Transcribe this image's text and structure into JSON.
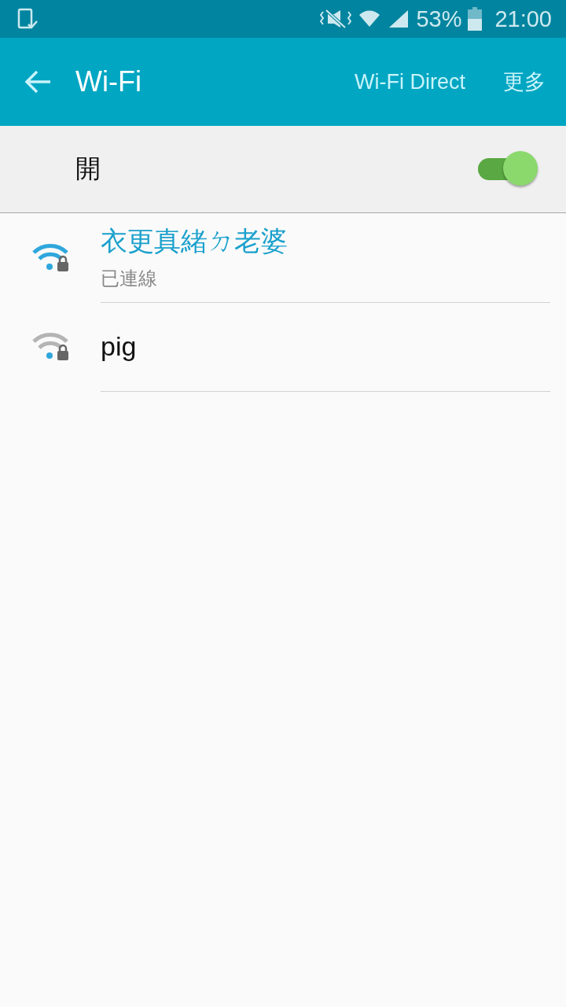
{
  "status_bar": {
    "battery": "53%",
    "time": "21:00"
  },
  "app_bar": {
    "title": "Wi-Fi",
    "actions": [
      "Wi-Fi Direct",
      "更多"
    ]
  },
  "master_switch": {
    "label": "開",
    "on": true
  },
  "networks": [
    {
      "name": "衣更真緒ㄉ老婆",
      "status": "已連線",
      "connected": true
    },
    {
      "name": "pig",
      "connected": false
    }
  ]
}
